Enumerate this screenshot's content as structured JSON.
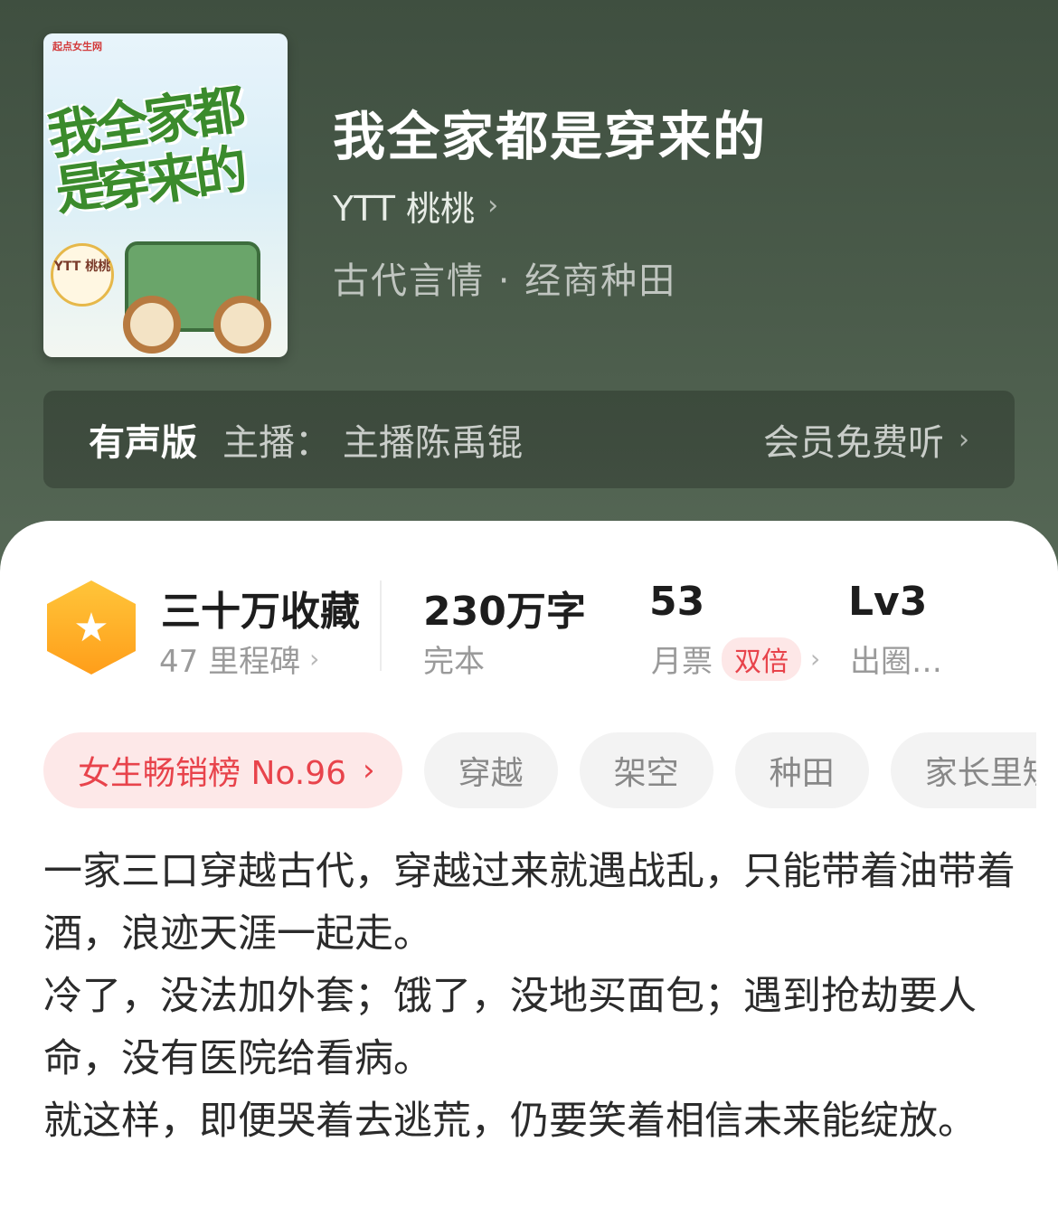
{
  "book": {
    "title": "我全家都是穿来的",
    "author": "YTT 桃桃",
    "category": "古代言情 · 经商种田",
    "cover": {
      "publisher": "起点女生网",
      "title_line1": "我全家都是",
      "title_line2": "穿来的",
      "author_seal": "YTT 桃桃"
    }
  },
  "audio": {
    "label": "有声版",
    "host": "主播：  主播陈禹锟",
    "free_text": "会员免费听"
  },
  "stats": {
    "favorites": "三十万收藏",
    "milestones": "47 里程碑",
    "word_count": "230万字",
    "status": "完本",
    "monthly_tickets": "53",
    "monthly_tickets_label": "月票",
    "double_tag": "双倍",
    "level": "Lv3",
    "level_label": "出圈…"
  },
  "tags": {
    "rank": "女生畅销榜 No.96",
    "items": [
      "穿越",
      "架空",
      "种田",
      "家长里短"
    ]
  },
  "description": [
    "一家三口穿越古代，穿越过来就遇战乱，只能带着油带着酒，浪迹天涯一起走。",
    "冷了，没法加外套；饿了，没地买面包；遇到抢劫要人命，没有医院给看病。",
    "就这样，即便哭着去逃荒，仍要笑着相信未来能绽放。"
  ],
  "colors": {
    "header_bg": "#4b5c4b",
    "accent_red": "#e8434b",
    "badge_orange": "#ffb02e"
  },
  "icons": {
    "badge": "star-icon",
    "chevron": "chevron-right-icon"
  }
}
